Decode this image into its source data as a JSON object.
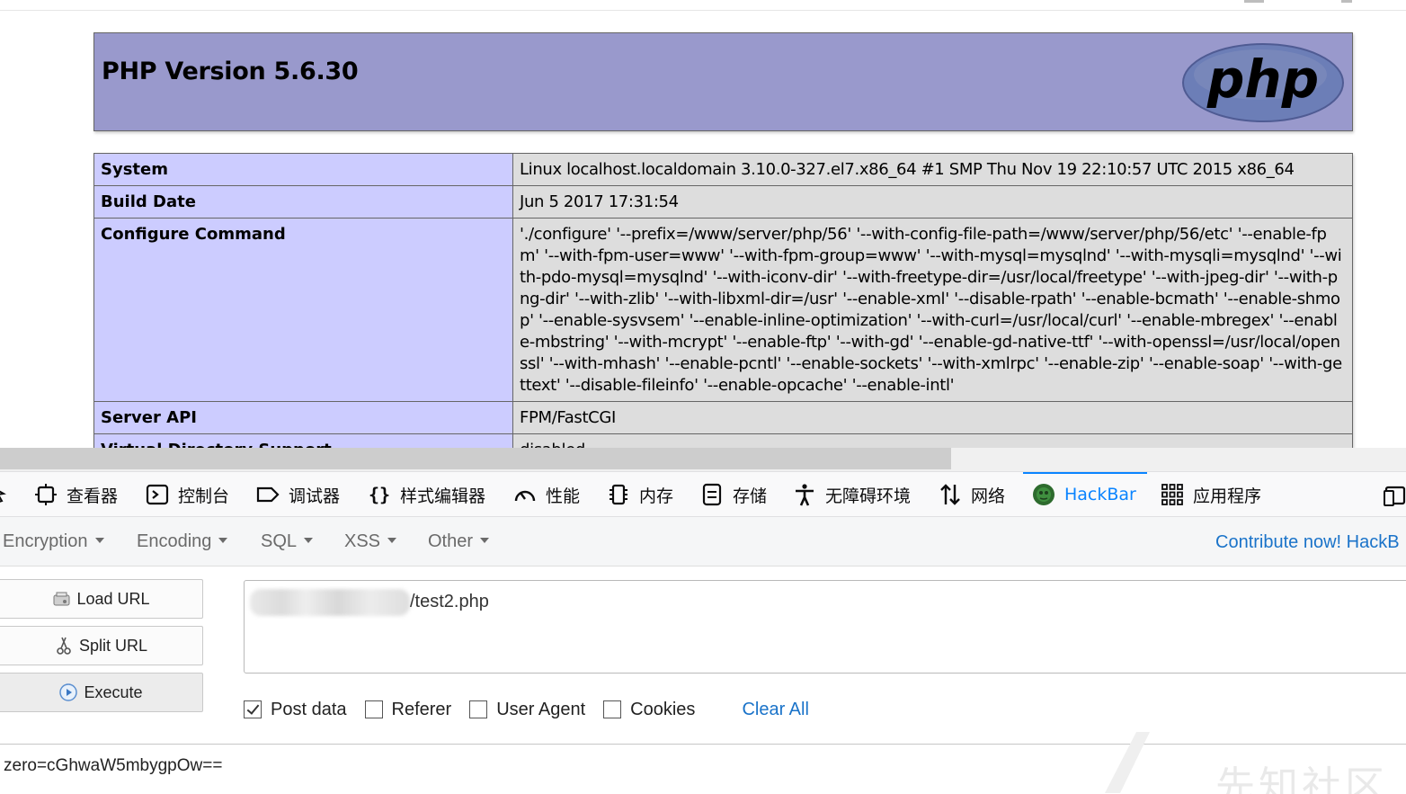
{
  "page": {
    "php_version_title": "PHP Version 5.6.30",
    "php_logo_text": "php",
    "info_rows": [
      {
        "key": "System",
        "value": "Linux localhost.localdomain 3.10.0-327.el7.x86_64 #1 SMP Thu Nov 19 22:10:57 UTC 2015 x86_64"
      },
      {
        "key": "Build Date",
        "value": "Jun 5 2017 17:31:54"
      },
      {
        "key": "Configure Command",
        "value": "'./configure' '--prefix=/www/server/php/56' '--with-config-file-path=/www/server/php/56/etc' '--enable-fpm' '--with-fpm-user=www' '--with-fpm-group=www' '--with-mysql=mysqlnd' '--with-mysqli=mysqlnd' '--with-pdo-mysql=mysqlnd' '--with-iconv-dir' '--with-freetype-dir=/usr/local/freetype' '--with-jpeg-dir' '--with-png-dir' '--with-zlib' '--with-libxml-dir=/usr' '--enable-xml' '--disable-rpath' '--enable-bcmath' '--enable-shmop' '--enable-sysvsem' '--enable-inline-optimization' '--with-curl=/usr/local/curl' '--enable-mbregex' '--enable-mbstring' '--with-mcrypt' '--enable-ftp' '--with-gd' '--enable-gd-native-ttf' '--with-openssl=/usr/local/openssl' '--with-mhash' '--enable-pcntl' '--enable-sockets' '--with-xmlrpc' '--enable-zip' '--enable-soap' '--with-gettext' '--disable-fileinfo' '--enable-opcache' '--enable-intl'"
      },
      {
        "key": "Server API",
        "value": "FPM/FastCGI"
      },
      {
        "key": "Virtual Directory Support",
        "value": "disabled"
      }
    ]
  },
  "devtools": {
    "tabs": [
      {
        "label": "查看器",
        "icon": "inspector-icon"
      },
      {
        "label": "控制台",
        "icon": "console-icon"
      },
      {
        "label": "调试器",
        "icon": "debugger-icon"
      },
      {
        "label": "样式编辑器",
        "icon": "style-editor-icon"
      },
      {
        "label": "性能",
        "icon": "performance-icon"
      },
      {
        "label": "内存",
        "icon": "memory-icon"
      },
      {
        "label": "存储",
        "icon": "storage-icon"
      },
      {
        "label": "无障碍环境",
        "icon": "accessibility-icon"
      },
      {
        "label": "网络",
        "icon": "network-icon"
      },
      {
        "label": "HackBar",
        "icon": "hackbar-icon"
      },
      {
        "label": "应用程序",
        "icon": "application-icon"
      }
    ],
    "selected_tab": "HackBar",
    "accent_color": "#0a84ff"
  },
  "hackbar": {
    "menu": [
      "Encryption",
      "Encoding",
      "SQL",
      "XSS",
      "Other"
    ],
    "contribute_text": "Contribute now! HackB",
    "buttons": {
      "load_url": "Load URL",
      "split_url": "Split URL",
      "execute": "Execute"
    },
    "url_value": "/test2.php",
    "options": {
      "post_data": "Post data",
      "referer": "Referer",
      "user_agent": "User Agent",
      "cookies": "Cookies",
      "clear_all": "Clear All"
    },
    "post_data_checked": true,
    "post_body": "zero=cGhwaW5mbygpOw==",
    "watermark_text": "先知社区"
  }
}
